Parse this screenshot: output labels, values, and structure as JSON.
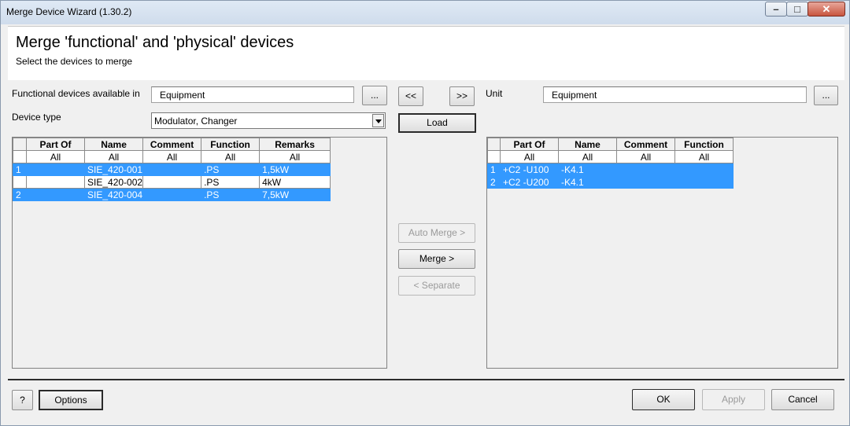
{
  "window": {
    "title": "Merge Device Wizard (1.30.2)"
  },
  "header": {
    "title": "Merge 'functional' and 'physical' devices",
    "subtitle": "Select the devices to merge"
  },
  "left": {
    "available_label": "Functional devices available in",
    "available_value": "Equipment",
    "browse_label": "...",
    "device_type_label": "Device type",
    "device_type_value": "Modulator, Changer",
    "columns": [
      "Part Of",
      "Name",
      "Comment",
      "Function",
      "Remarks"
    ],
    "filters": [
      "All",
      "All",
      "All",
      "All",
      "All"
    ],
    "rows": [
      {
        "num": "1",
        "part_of": "",
        "name": "SIE_420-001",
        "comment": "",
        "function": ".PS",
        "remarks": "1,5kW",
        "selected": true
      },
      {
        "num": "",
        "part_of": "",
        "name": "SIE_420-002",
        "comment": "",
        "function": ".PS",
        "remarks": "4kW",
        "selected": false
      },
      {
        "num": "2",
        "part_of": "",
        "name": "SIE_420-004",
        "comment": "",
        "function": ".PS",
        "remarks": "7,5kW",
        "selected": true
      }
    ]
  },
  "middle": {
    "prev_label": "<<",
    "next_label": ">>",
    "load_label": "Load",
    "auto_merge_label": "Auto Merge >",
    "merge_label": "Merge >",
    "separate_label": "< Separate"
  },
  "right": {
    "unit_label": "Unit",
    "unit_value": "Equipment",
    "browse_label": "...",
    "columns": [
      "Part Of",
      "Name",
      "Comment",
      "Function"
    ],
    "filters": [
      "All",
      "All",
      "All",
      "All"
    ],
    "rows": [
      {
        "num": "1",
        "part_of": "+C2 -U100",
        "name": "-K4.1",
        "comment": "",
        "function": "",
        "selected": true
      },
      {
        "num": "2",
        "part_of": "+C2 -U200",
        "name": "-K4.1",
        "comment": "",
        "function": "",
        "selected": true
      }
    ]
  },
  "footer": {
    "help_label": "?",
    "options_label": "Options",
    "ok_label": "OK",
    "apply_label": "Apply",
    "cancel_label": "Cancel"
  },
  "colors": {
    "selection": "#3399ff",
    "face": "#f0f0f0"
  },
  "icons": [
    "minimize-icon",
    "maximize-icon",
    "close-icon",
    "dropdown-arrow-icon"
  ]
}
